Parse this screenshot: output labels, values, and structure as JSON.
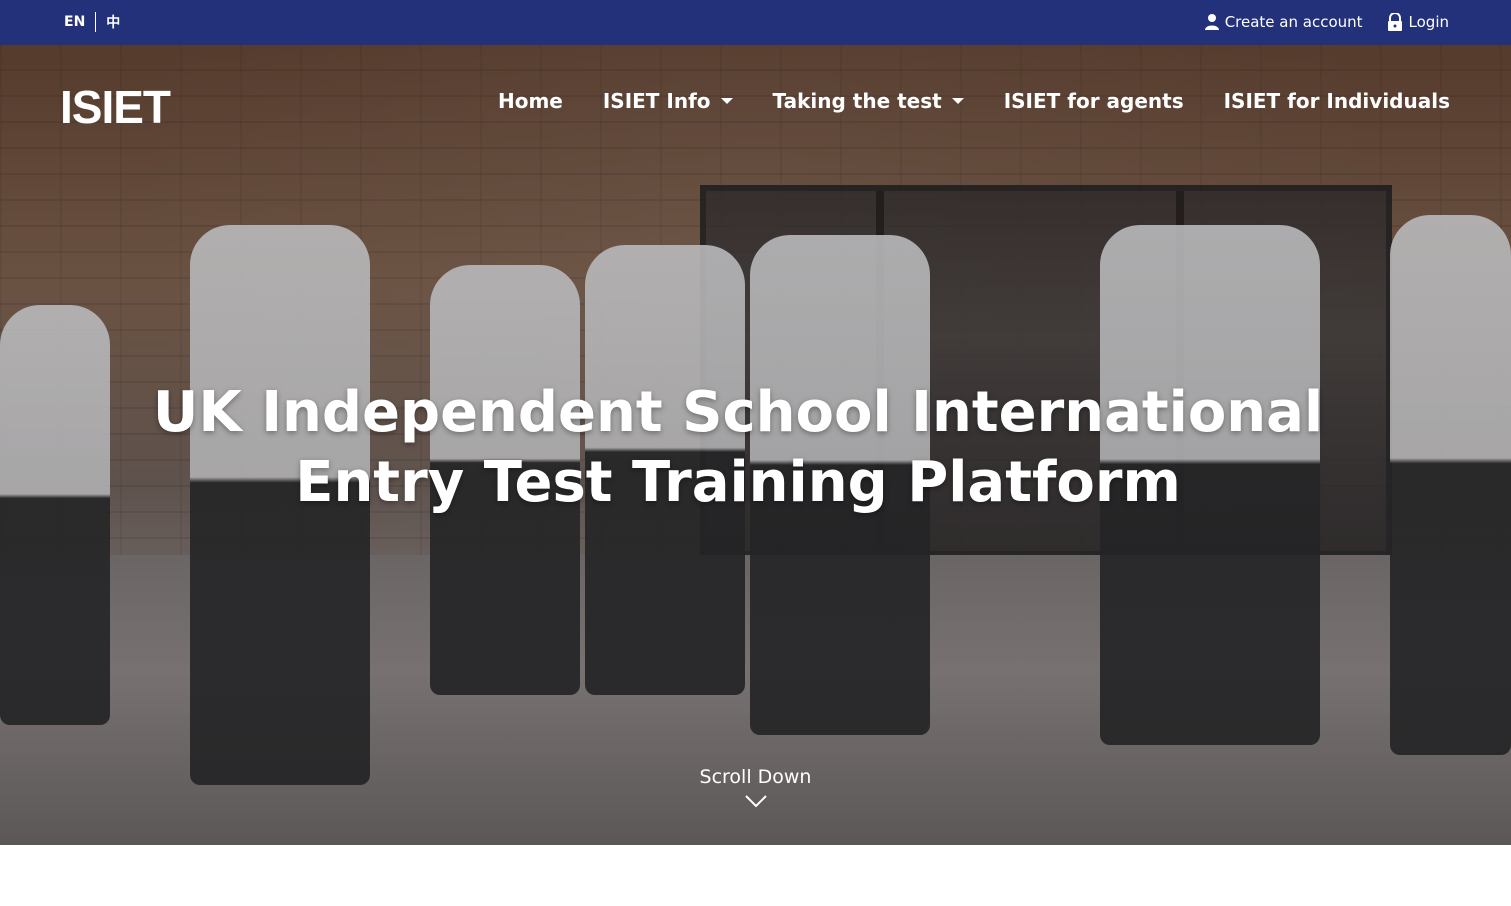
{
  "topbar": {
    "languages": [
      "EN",
      "中"
    ],
    "create_account": "Create an account",
    "login": "Login",
    "icons": {
      "create_account": "user-icon",
      "login": "lock-icon"
    }
  },
  "brand": "ISIET",
  "nav": {
    "items": [
      {
        "label": "Home"
      },
      {
        "label": "ISIET Info",
        "dropdown": true
      },
      {
        "label": "Taking the test",
        "dropdown": true
      },
      {
        "label": "ISIET for agents"
      },
      {
        "label": "ISIET for Individuals"
      }
    ]
  },
  "hero": {
    "headline_line1": "UK Independent School International",
    "headline_line2": "Entry Test Training Platform",
    "scroll_label": "Scroll Down",
    "scroll_icon": "chevron-down-icon"
  },
  "colors": {
    "topbar_bg": "#23307a",
    "text": "#ffffff"
  }
}
